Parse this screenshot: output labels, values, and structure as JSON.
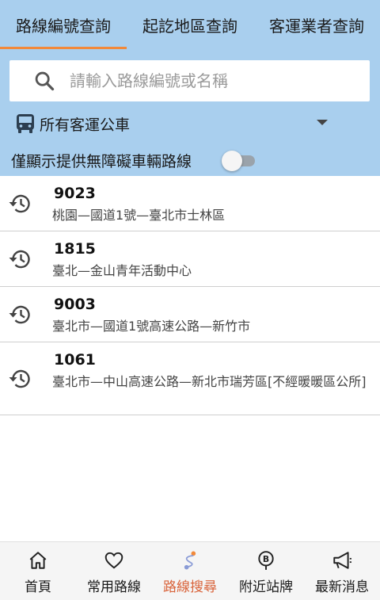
{
  "tabs": [
    {
      "label": "路線編號查詢",
      "active": true
    },
    {
      "label": "起訖地區查詢",
      "active": false
    },
    {
      "label": "客運業者查詢",
      "active": false
    }
  ],
  "search": {
    "placeholder": "請輸入路線編號或名稱",
    "value": ""
  },
  "filter": {
    "operator_type": "所有客運公車"
  },
  "barrier_free": {
    "label": "僅顯示提供無障礙車輛路線",
    "enabled": false
  },
  "history": [
    {
      "route_no": "9023",
      "description": "桃園—國道1號—臺北市士林區"
    },
    {
      "route_no": "1815",
      "description": "臺北—金山青年活動中心"
    },
    {
      "route_no": "9003",
      "description": "臺北市—國道1號高速公路—新竹市"
    },
    {
      "route_no": "1061",
      "description": "臺北市—中山高速公路—新北市瑞芳區[不經暖暖區公所]"
    }
  ],
  "nav": [
    {
      "label": "首頁",
      "icon": "home-icon"
    },
    {
      "label": "常用路線",
      "icon": "heart-icon"
    },
    {
      "label": "路線搜尋",
      "icon": "route-icon",
      "active": true
    },
    {
      "label": "附近站牌",
      "icon": "bus-stop-icon"
    },
    {
      "label": "最新消息",
      "icon": "megaphone-icon"
    }
  ],
  "colors": {
    "header_bg": "#a9cfee",
    "accent": "#f2893a",
    "active_nav": "#d9633a"
  }
}
